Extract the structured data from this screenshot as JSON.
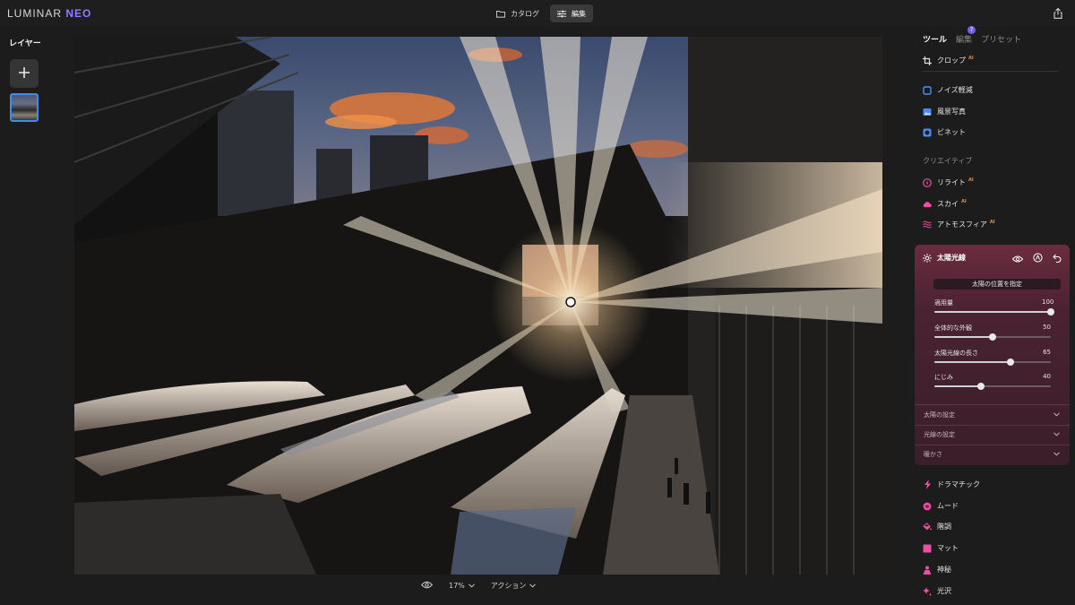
{
  "app": {
    "logo_main": "LUMINAR",
    "logo_sub": "NEO"
  },
  "top_tabs": [
    {
      "label": "カタログ",
      "icon": "folder-icon",
      "active": false
    },
    {
      "label": "編集",
      "icon": "sliders-icon",
      "active": true
    }
  ],
  "layers": {
    "title": "レイヤー",
    "add_icon": "plus-icon"
  },
  "bottombar": {
    "zoom": "17%",
    "actions": "アクション"
  },
  "right_panel": {
    "tabs": [
      {
        "label": "ツール",
        "active": true
      },
      {
        "label": "編集",
        "active": false,
        "badge": "7"
      },
      {
        "label": "プリセット",
        "active": false
      }
    ],
    "crop": {
      "label": "クロップ",
      "ai": "AI"
    },
    "essentials": [
      {
        "label": "ノイズ軽減",
        "icon": "noise-icon",
        "color": "#4a8cff"
      },
      {
        "label": "風景写真",
        "icon": "landscape-icon",
        "color": "#4a8cff"
      },
      {
        "label": "ビネット",
        "icon": "vignette-icon",
        "color": "#4a8cff"
      }
    ],
    "creative_title": "クリエイティブ",
    "creative": [
      {
        "label": "リライト",
        "ai": "AI",
        "icon": "relight-icon",
        "color": "#f04ca8"
      },
      {
        "label": "スカイ",
        "ai": "AI",
        "icon": "cloud-icon",
        "color": "#f04ca8"
      },
      {
        "label": "アトモスフィア",
        "ai": "AI",
        "icon": "atmosphere-icon",
        "color": "#f04ca8"
      }
    ],
    "sun_rays": {
      "title": "太陽光線",
      "place_button": "太陽の位置を指定",
      "sliders": [
        {
          "label": "適用量",
          "value": 100,
          "min": 0,
          "max": 100
        },
        {
          "label": "全体的な外観",
          "value": 50,
          "min": 0,
          "max": 100
        },
        {
          "label": "太陽光線の長さ",
          "value": 65,
          "min": 0,
          "max": 100
        },
        {
          "label": "にじみ",
          "value": 40,
          "min": 0,
          "max": 100
        }
      ],
      "sections": [
        "太陽の設定",
        "光線の設定",
        "暖かさ"
      ]
    },
    "more_tools": [
      {
        "label": "ドラマチック",
        "icon": "bolt-icon",
        "color": "#f04ca8"
      },
      {
        "label": "ムード",
        "icon": "mood-icon",
        "color": "#f04ca8"
      },
      {
        "label": "階調",
        "icon": "bucket-icon",
        "color": "#f04ca8"
      },
      {
        "label": "マット",
        "icon": "matte-icon",
        "color": "#f04ca8"
      },
      {
        "label": "神秘",
        "icon": "mystic-icon",
        "color": "#f04ca8"
      },
      {
        "label": "光沢",
        "icon": "sparkle-icon",
        "color": "#f04ca8"
      }
    ]
  },
  "colors": {
    "accent_blue": "#3b8df0",
    "accent_pink": "#f04ca8",
    "ai_orange": "#f28a2a",
    "sun_card": "#5a2637"
  }
}
